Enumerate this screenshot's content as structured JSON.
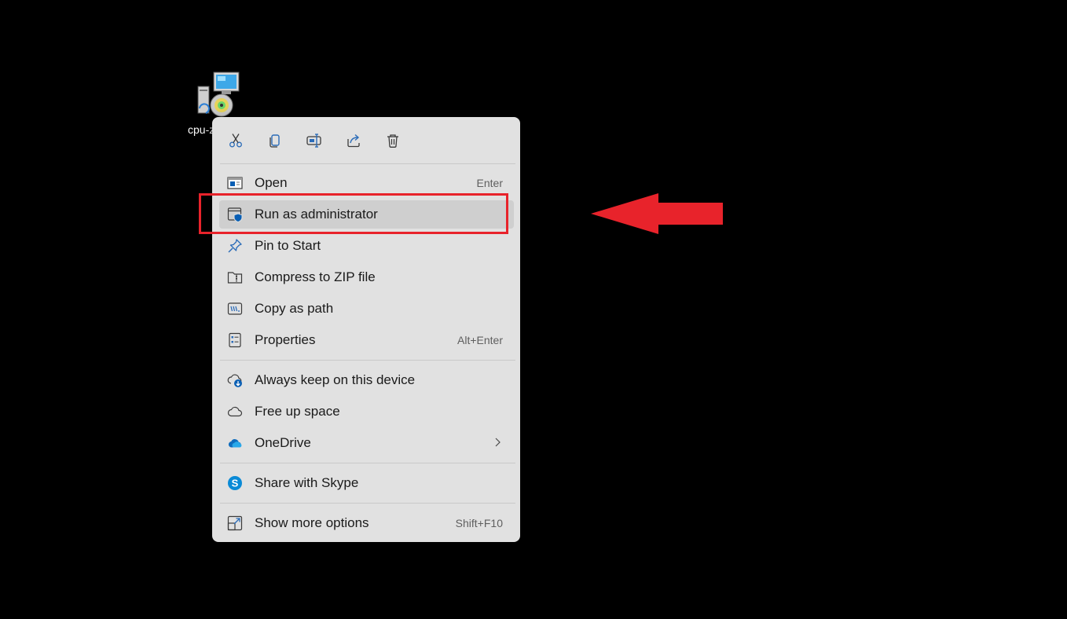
{
  "desktop": {
    "icon_label": "cpu-z",
    "icon_name": "installer-icon"
  },
  "toolbar": [
    {
      "name": "cut-icon",
      "tooltip": "Cut"
    },
    {
      "name": "copy-icon",
      "tooltip": "Copy"
    },
    {
      "name": "rename-icon",
      "tooltip": "Rename"
    },
    {
      "name": "share-icon",
      "tooltip": "Share"
    },
    {
      "name": "delete-icon",
      "tooltip": "Delete"
    }
  ],
  "menu": {
    "open": {
      "label": "Open",
      "shortcut": "Enter",
      "icon": "open-window-icon"
    },
    "run_admin": {
      "label": "Run as administrator",
      "icon": "shield-icon"
    },
    "pin_start": {
      "label": "Pin to Start",
      "icon": "pin-icon"
    },
    "compress_zip": {
      "label": "Compress to ZIP file",
      "icon": "zip-folder-icon"
    },
    "copy_path": {
      "label": "Copy as path",
      "icon": "path-icon"
    },
    "properties": {
      "label": "Properties",
      "shortcut": "Alt+Enter",
      "icon": "properties-icon"
    },
    "always_keep": {
      "label": "Always keep on this device",
      "icon": "cloud-download-icon"
    },
    "free_space": {
      "label": "Free up space",
      "icon": "cloud-icon"
    },
    "onedrive": {
      "label": "OneDrive",
      "icon": "onedrive-icon"
    },
    "share_skype": {
      "label": "Share with Skype",
      "icon": "skype-icon"
    },
    "more_options": {
      "label": "Show more options",
      "shortcut": "Shift+F10",
      "icon": "more-options-icon"
    }
  },
  "colors": {
    "menu_background": "#e1e1e1",
    "highlight_annotation": "#e8232b",
    "accent": "#0067c0"
  }
}
